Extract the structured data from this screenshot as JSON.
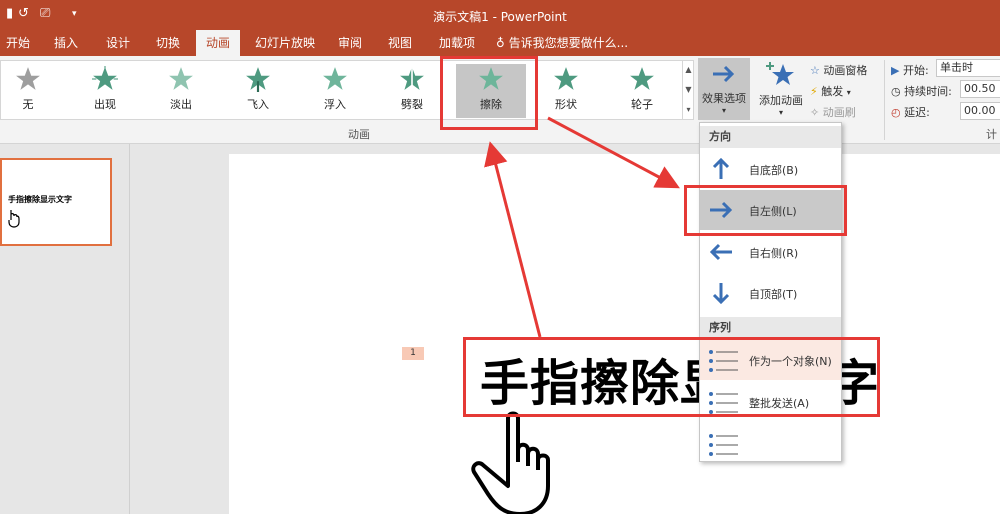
{
  "window": {
    "title": "演示文稿1 - PowerPoint"
  },
  "tabs": [
    "开始",
    "插入",
    "设计",
    "切换",
    "动画",
    "幻灯片放映",
    "审阅",
    "视图",
    "加载项"
  ],
  "tell_me": "告诉我您想要做什么...",
  "animations": [
    {
      "label": "无"
    },
    {
      "label": "出现"
    },
    {
      "label": "淡出"
    },
    {
      "label": "飞入"
    },
    {
      "label": "浮入"
    },
    {
      "label": "劈裂"
    },
    {
      "label": "擦除"
    },
    {
      "label": "形状"
    },
    {
      "label": "轮子"
    }
  ],
  "group_label": "动画",
  "effect_options_label": "效果选项",
  "add_animation_label": "添加动画",
  "advanced": {
    "pane": "动画窗格",
    "trigger": "触发",
    "painter": "动画刷"
  },
  "timing": {
    "start_label": "开始:",
    "start_value": "单击时",
    "duration_label": "持续时间:",
    "duration_value": "00.50",
    "delay_label": "延迟:",
    "delay_value": "00.00",
    "group_partial": "计"
  },
  "slide": {
    "thumb_text": "手指擦除显示文字",
    "number_tag": "1",
    "big_text": "手指擦除显示文字"
  },
  "dropdown": {
    "direction_header": "方向",
    "directions": [
      "自底部(B)",
      "自左侧(L)",
      "自右侧(R)",
      "自顶部(T)"
    ],
    "sequence_header": "序列",
    "sequences": [
      "作为一个对象(N)",
      "整批发送(A)"
    ]
  },
  "colors": {
    "brand": "#b7472a",
    "star": "#4e9a80",
    "arrow": "#3a6fb5",
    "annotation": "#e53935"
  }
}
